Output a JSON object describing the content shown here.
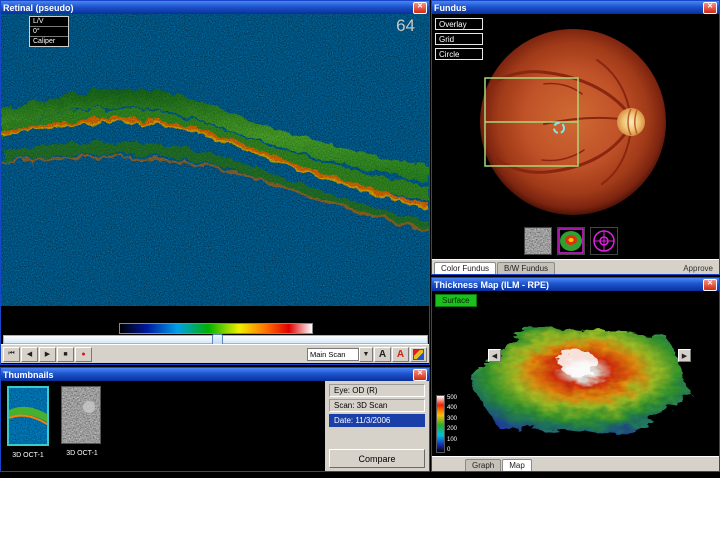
{
  "window_controls": {
    "close": "✕"
  },
  "oct": {
    "title": "Retinal (pseudo)",
    "frame_number": "64",
    "menu_items": [
      {
        "label": "L/V"
      },
      {
        "label": "0°"
      },
      {
        "label": "Caliper"
      }
    ],
    "transport": {
      "first": "⏮",
      "prev": "◀",
      "play": "▶",
      "stop": "■",
      "record": "●"
    },
    "scan_select": {
      "value": "Main Scan",
      "arrow": "▼"
    },
    "font_button": "A",
    "annotate_button": "A"
  },
  "thumbnails": {
    "title": "Thumbnails",
    "items": [
      {
        "label": "3D OCT-1"
      },
      {
        "label": "3D OCT-1"
      }
    ],
    "info": [
      {
        "text": "Eye: OD (R)"
      },
      {
        "text": "Scan: 3D Scan"
      },
      {
        "text": "Date: 11/3/2006"
      }
    ],
    "compare_label": "Compare"
  },
  "fundus": {
    "title": "Fundus",
    "overlay_buttons": [
      {
        "label": "Overlay"
      },
      {
        "label": "Grid"
      },
      {
        "label": "Circle"
      }
    ],
    "tabs": [
      {
        "label": "Color Fundus"
      },
      {
        "label": "B/W Fundus"
      }
    ],
    "approve_label": "Approve"
  },
  "thickness": {
    "title": "Thickness Map  (ILM - RPE)",
    "surface_label": "Surface",
    "legend_values": [
      "500",
      "400",
      "300",
      "200",
      "100",
      "0"
    ],
    "tabs": [
      {
        "label": "Graph"
      },
      {
        "label": "Map"
      }
    ],
    "rotate": {
      "left": "◀",
      "right": "▶"
    }
  },
  "colors": {
    "titlebar_blue": "#1c54cc",
    "selection_blue": "#1a3fa8",
    "thumb_selected_cyan": "#38cccc",
    "surface_green": "#1cc01c",
    "record_red": "#d81818"
  }
}
